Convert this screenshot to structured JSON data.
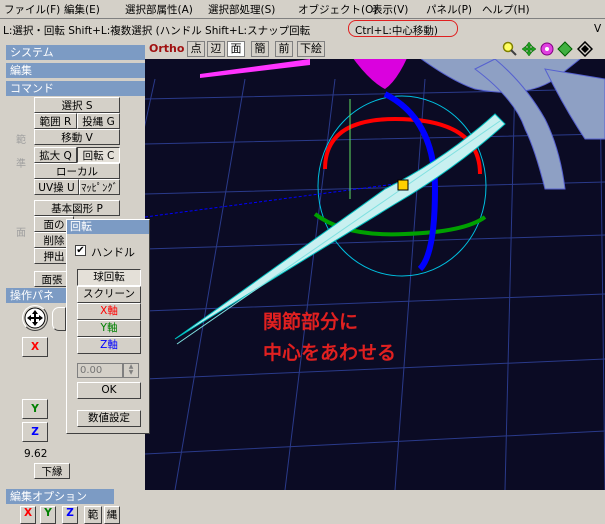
{
  "menu": {
    "items": [
      "ファイル(F)",
      "編集(E)",
      "選択部属性(A)",
      "選択部処理(S)",
      "オブジェクト(O)",
      "表示(V)",
      "パネル(P)",
      "ヘルプ(H)"
    ]
  },
  "status": {
    "main": "L:選択・回転  Shift+L:複数選択 (ハンドル Shift+L:スナップ回転",
    "highlight": "Ctrl+L:中心移動)",
    "right": "V"
  },
  "panels": {
    "system": "システム",
    "edit": "編集",
    "command": "コマンド",
    "surface": "面張",
    "operation": "操作パネ",
    "edit_option": "編集オプション"
  },
  "commands": {
    "select": "選択 S",
    "range": "範囲 R",
    "lasso": "投縄 G",
    "move": "移動 V",
    "scale": "拡大 Q",
    "rotate": "回転 C",
    "local": "ローカル",
    "uv": "UV操 U",
    "mapping": "ﾏｯﾋﾟﾝｸﾞ",
    "basic_shape": "基本図形 P",
    "face": "面の",
    "delete": "削除",
    "extrude": "押出",
    "bottom": "下縁",
    "side_a": "範",
    "side_b": "準",
    "side_c": "面"
  },
  "operation": {
    "value": "9.62",
    "x": "X",
    "y": "Y",
    "z": "Z"
  },
  "edit_option": {
    "x": "X",
    "y": "Y",
    "z": "Z",
    "range": "範",
    "rope": "縄"
  },
  "view_toolbar": {
    "ortho": "Ortho",
    "point": "点",
    "edge": "辺",
    "face": "面",
    "simple": "簡",
    "front": "前",
    "bottom": "下絵"
  },
  "rotate_dialog": {
    "title": "回転",
    "handle_label": "ハンドル",
    "handle_checked": true,
    "sphere_rotate": "球回転",
    "screen": "スクリーン",
    "x_axis": "X軸",
    "y_axis": "Y軸",
    "z_axis": "Z軸",
    "value_placeholder": "0.00",
    "ok": "OK",
    "numeric_setting": "数値設定"
  },
  "annotation": {
    "line1": "関節部分に",
    "line2": "中心をあわせる"
  },
  "colors": {
    "x_axis": "#ff0000",
    "y_axis": "#008000",
    "z_axis": "#0000ff",
    "annotation": "#e02020",
    "highlight_ring": "#e02020",
    "viewport_bg": "#0b0b24"
  }
}
